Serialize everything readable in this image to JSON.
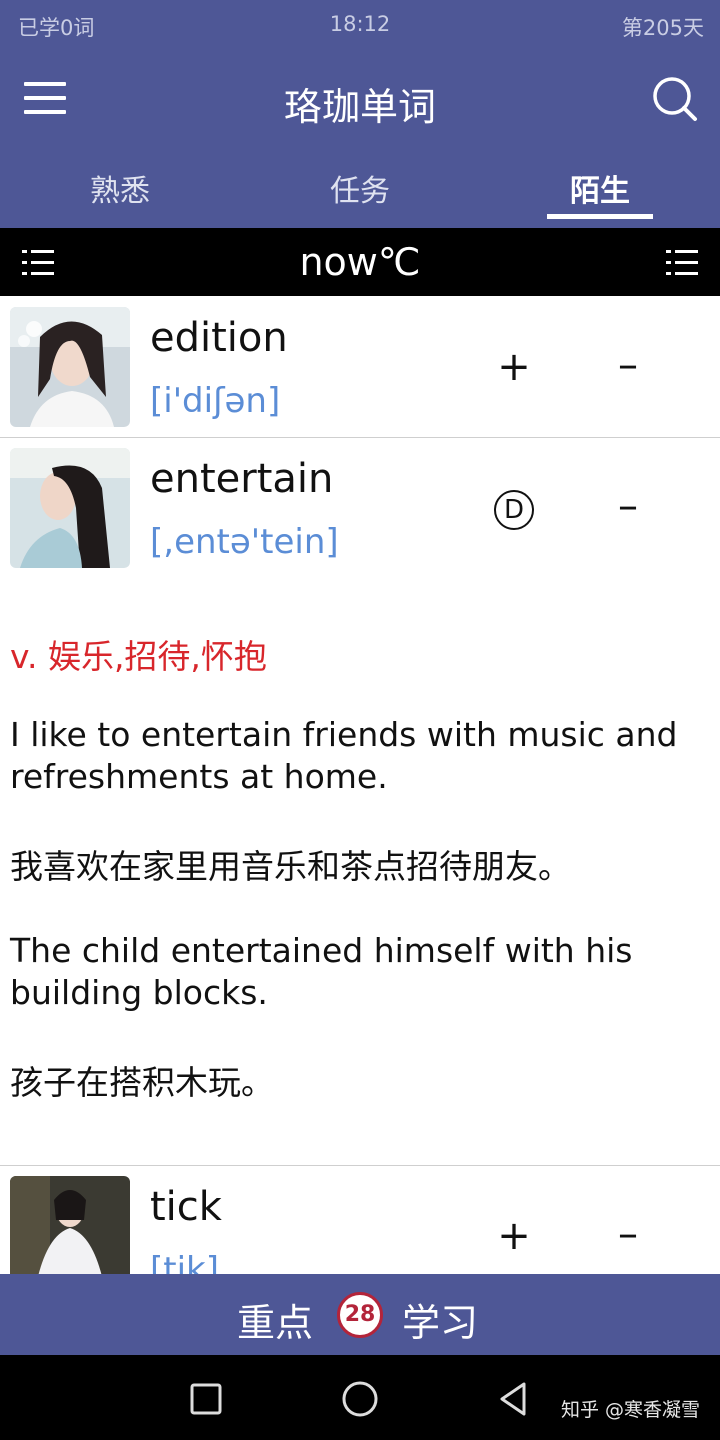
{
  "status_bar": {
    "left": "已学0词",
    "time": "18:12",
    "right": "第205天"
  },
  "app_bar": {
    "title": "珞珈单词",
    "menu_icon": "hamburger-menu-icon",
    "search_icon": "search-icon"
  },
  "tabs": [
    {
      "label": "熟悉",
      "active": false
    },
    {
      "label": "任务",
      "active": false
    },
    {
      "label": "陌生",
      "active": true
    }
  ],
  "info_bar": {
    "text": "now℃",
    "left_icon": "list-icon",
    "right_icon": "list-icon"
  },
  "words": [
    {
      "word": "edition",
      "phonetic": "[i'diʃən]",
      "add_label": "+",
      "remove_label": "–"
    },
    {
      "word": "entertain",
      "phonetic": "[,entə'tein]",
      "badge": "D",
      "remove_label": "–"
    },
    {
      "word": "tick",
      "phonetic": "[tik]",
      "add_label": "+",
      "remove_label": "–"
    }
  ],
  "detail": {
    "meaning": "v. 娱乐,招待,怀抱",
    "examples": [
      "I like to entertain friends with music and refreshments at home.",
      "我喜欢在家里用音乐和茶点招待朋友。",
      "The child entertained himself with his building blocks.",
      "孩子在搭积木玩。"
    ]
  },
  "bottom_bar": {
    "left_label": "重点",
    "count": "28",
    "right_label": "学习"
  },
  "nav_bar": {
    "watermark": "知乎 @寒香凝雪"
  },
  "colors": {
    "primary": "#4e5796",
    "phonetic": "#5b8dd6",
    "meaning": "#d8262b",
    "badge_ring": "#b3243a"
  }
}
